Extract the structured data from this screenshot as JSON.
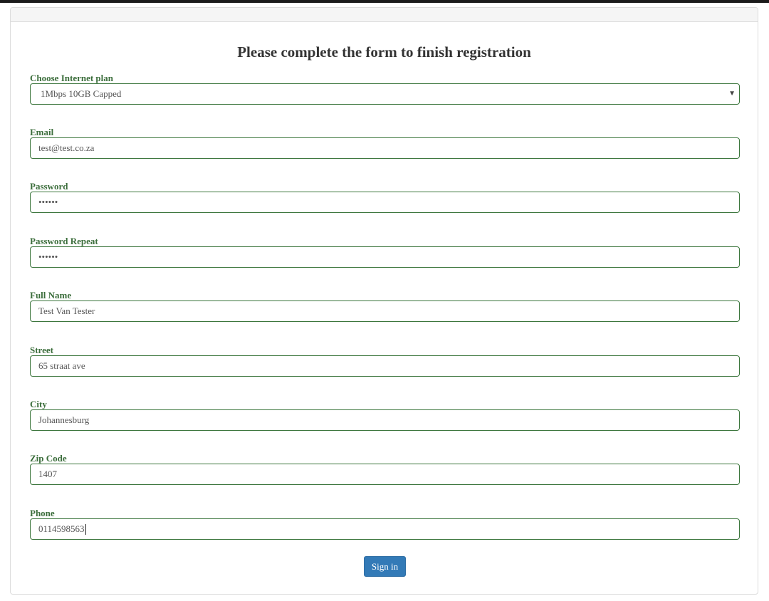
{
  "form": {
    "title": "Please complete the form to finish registration",
    "fields": {
      "plan": {
        "label": "Choose Internet plan",
        "value": "1Mbps 10GB Capped"
      },
      "email": {
        "label": "Email",
        "value": "test@test.co.za"
      },
      "password": {
        "label": "Password",
        "value": "••••••"
      },
      "password_repeat": {
        "label": "Password Repeat",
        "value": "••••••"
      },
      "full_name": {
        "label": "Full Name",
        "value": "Test Van Tester"
      },
      "street": {
        "label": "Street",
        "value": "65 straat ave"
      },
      "city": {
        "label": "City",
        "value": "Johannesburg"
      },
      "zip": {
        "label": "Zip Code",
        "value": "1407"
      },
      "phone": {
        "label": "Phone",
        "value": "0114598563"
      }
    },
    "submit_label": "Sign in"
  },
  "icons": {
    "select_arrow": "chevron-down-icon"
  },
  "colors": {
    "label": "#3c6e3c",
    "input_border": "#3c763d",
    "primary_button": "#337ab7",
    "panel_heading": "#f5f5f5"
  }
}
